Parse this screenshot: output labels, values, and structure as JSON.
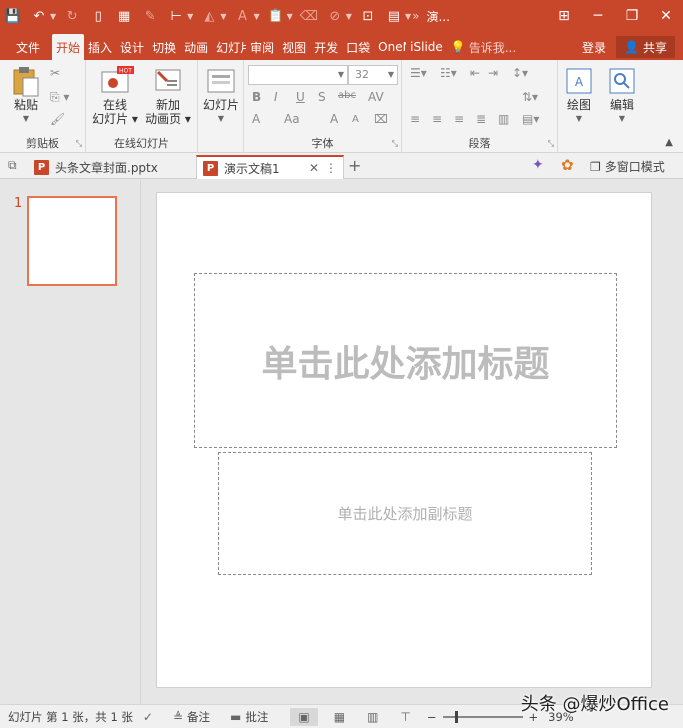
{
  "titlebar": {
    "title": "演...",
    "qat_icons": [
      "save-icon",
      "undo-icon",
      "redo-icon",
      "new-file-icon",
      "grid-icon",
      "pen-icon",
      "format-painter-icon",
      "fill-color-icon",
      "font-color-icon",
      "paste-icon",
      "erase-icon",
      "shapes-icon",
      "screenshot-icon",
      "theme-icon"
    ],
    "window_controls": [
      "ribbon-display-icon",
      "minimize-icon",
      "restore-icon",
      "close-icon"
    ]
  },
  "ribbon_tabs": [
    "文件",
    "开始",
    "插入",
    "设计",
    "切换",
    "动画",
    "幻灯片",
    "审阅",
    "视图",
    "开发",
    "口袋",
    "OneN",
    "iSlide"
  ],
  "active_tab": "开始",
  "tell_me": "告诉我...",
  "login": "登录",
  "share": "共享",
  "groups": {
    "clipboard": {
      "label": "剪贴板",
      "paste": "粘贴"
    },
    "online_slides": {
      "label": "在线幻灯片",
      "online_btn": [
        "在线",
        "幻灯片"
      ],
      "new_btn": [
        "新加",
        "动画页"
      ],
      "badge": "HOT"
    },
    "slides": {
      "label": "幻灯片",
      "button": "幻灯片"
    },
    "font": {
      "label": "字体",
      "font_name": "",
      "font_size": "32",
      "buttons": [
        "B",
        "I",
        "U",
        "S",
        "abc",
        "AV",
        "A",
        "Aa",
        "A",
        "A"
      ]
    },
    "paragraph": {
      "label": "段落"
    },
    "drawing": {
      "button": "绘图"
    },
    "editing": {
      "button": "编辑"
    }
  },
  "doc_tabs": [
    {
      "label": "头条文章封面.pptx",
      "active": false
    },
    {
      "label": "演示文稿1",
      "active": true
    }
  ],
  "multiwindow": "多窗口模式",
  "thumbnails": [
    {
      "number": "1"
    }
  ],
  "slide": {
    "title_placeholder": "单击此处添加标题",
    "subtitle_placeholder": "单击此处添加副标题"
  },
  "statusbar": {
    "slide_info": "幻灯片 第 1 张，共 1 张",
    "notes": "备注",
    "comments": "批注",
    "zoom": 39,
    "zoom_label": "39%"
  },
  "watermark": "头条 @爆炒Office",
  "colors": {
    "accent": "#c8462a",
    "thumb_border": "#e8734f"
  }
}
